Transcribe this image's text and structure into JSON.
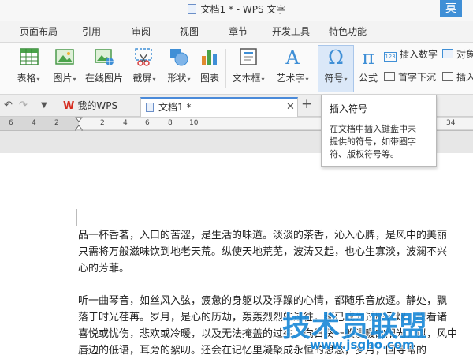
{
  "window": {
    "title": "文档1 * - WPS 文字",
    "ime_badge": "莫"
  },
  "menu": {
    "tabs": [
      "页面布局",
      "引用",
      "审阅",
      "视图",
      "章节",
      "开发工具",
      "特色功能"
    ]
  },
  "ribbon": {
    "table": "表格",
    "picture": "图片",
    "online_picture": "在线图片",
    "screenshot": "截屏",
    "shape": "形状",
    "chart": "图表",
    "textbox": "文本框",
    "wordart": "艺术字",
    "symbol": "符号",
    "formula": "公式",
    "insert_number": "插入数字",
    "drop_cap": "首字下沉",
    "object": "对象",
    "attach": "插入"
  },
  "tabs": {
    "my_wps": "我的WPS",
    "doc1": "文档1 *"
  },
  "ruler": {
    "ticks": [
      "6",
      "4",
      "2",
      "2",
      "4",
      "6",
      "8",
      "10",
      "34"
    ]
  },
  "tooltip": {
    "title": "插入符号",
    "body": "在文档中插入键盘中未\n提供的符号，如带圈字\n符、版权符号等。"
  },
  "document": {
    "lines": [
      "品一杯香茗，入口的苦涩，是生活的味道。淡淡的茶香，沁入心脾，是风中的美丽",
      "只需将万般滋味饮到地老天荒。纵使天地荒芜，波涛又起，也心生寡淡，波澜不兴",
      "心的芳菲。",
      "",
      "听一曲琴音，如丝风入弦，疲惫的身躯以及浮躁的心情，都随乐音放逐。静处，飘",
      "落于时光荏苒。岁月，是心的历劫，轰轰烈烈的过往，都已成为过眼云烟，积看诸",
      "喜悦或忧伤，悲欢或冷暖，以及无法掩盖的过往。向日葵一般温暖的阳光，似，风中",
      "唇边的低语，耳旁的絮叨。还会在记忆里凝聚成永恒的思念，岁月，回寻常的"
    ]
  },
  "watermark": {
    "brand": "技术员联盟",
    "url": "www.jsgho.com"
  },
  "colors": {
    "accent": "#4a8ad9",
    "wps_red": "#d52b1e",
    "watermark": "#1d8ad8"
  }
}
